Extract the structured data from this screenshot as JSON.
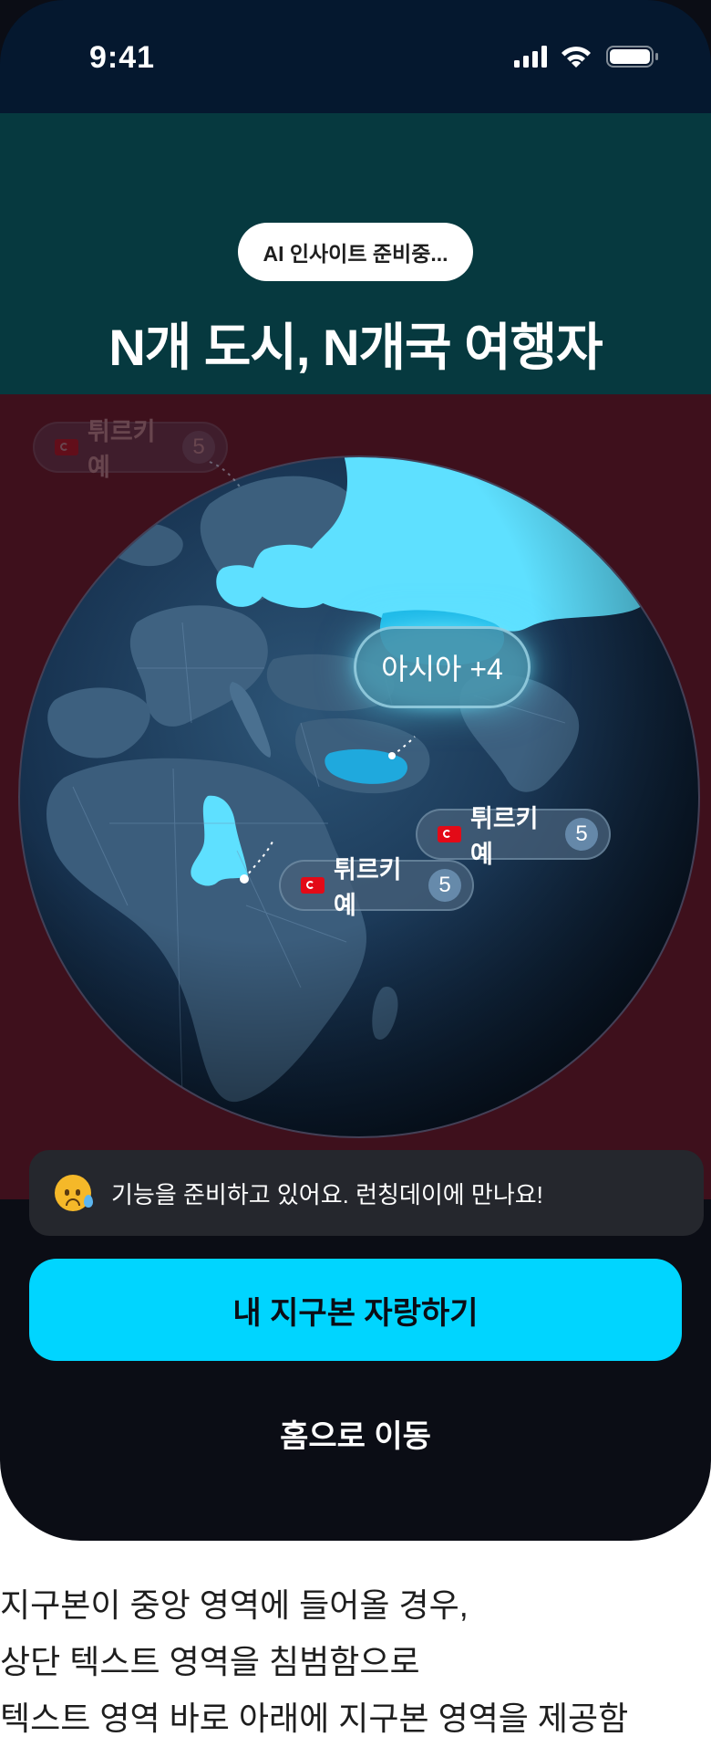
{
  "status_bar": {
    "time": "9:41",
    "icons": [
      "signal-icon",
      "wifi-icon",
      "battery-icon"
    ]
  },
  "header": {
    "badge": "AI 인사이트 준비중...",
    "title": "N개 도시, N개국 여행자"
  },
  "globe": {
    "region_bubble": "아시아 +4",
    "tags": [
      {
        "country": "튀르키예",
        "count": "5",
        "state": "faded"
      },
      {
        "country": "튀르키예",
        "count": "5",
        "state": "active"
      },
      {
        "country": "튀르키예",
        "count": "5",
        "state": "active"
      }
    ]
  },
  "toast": {
    "icon": "sad-tear-emoji-icon",
    "text": "기능을 준비하고 있어요. 런칭데이에 만나요!"
  },
  "actions": {
    "primary": "내 지구본 자랑하기",
    "secondary": "홈으로 이동"
  },
  "caption": [
    "지구본이 중앙 영역에 들어올 경우,",
    "상단 텍스트 영역을 침범함으로",
    "텍스트 영역 바로 아래에 지구본 영역을 제공함"
  ],
  "colors": {
    "accent": "#00d5ff",
    "header_band": "#06393f",
    "globe_band": "#3e101c",
    "status_bar": "#05182f",
    "highlight_region": "#5ee0ff"
  }
}
